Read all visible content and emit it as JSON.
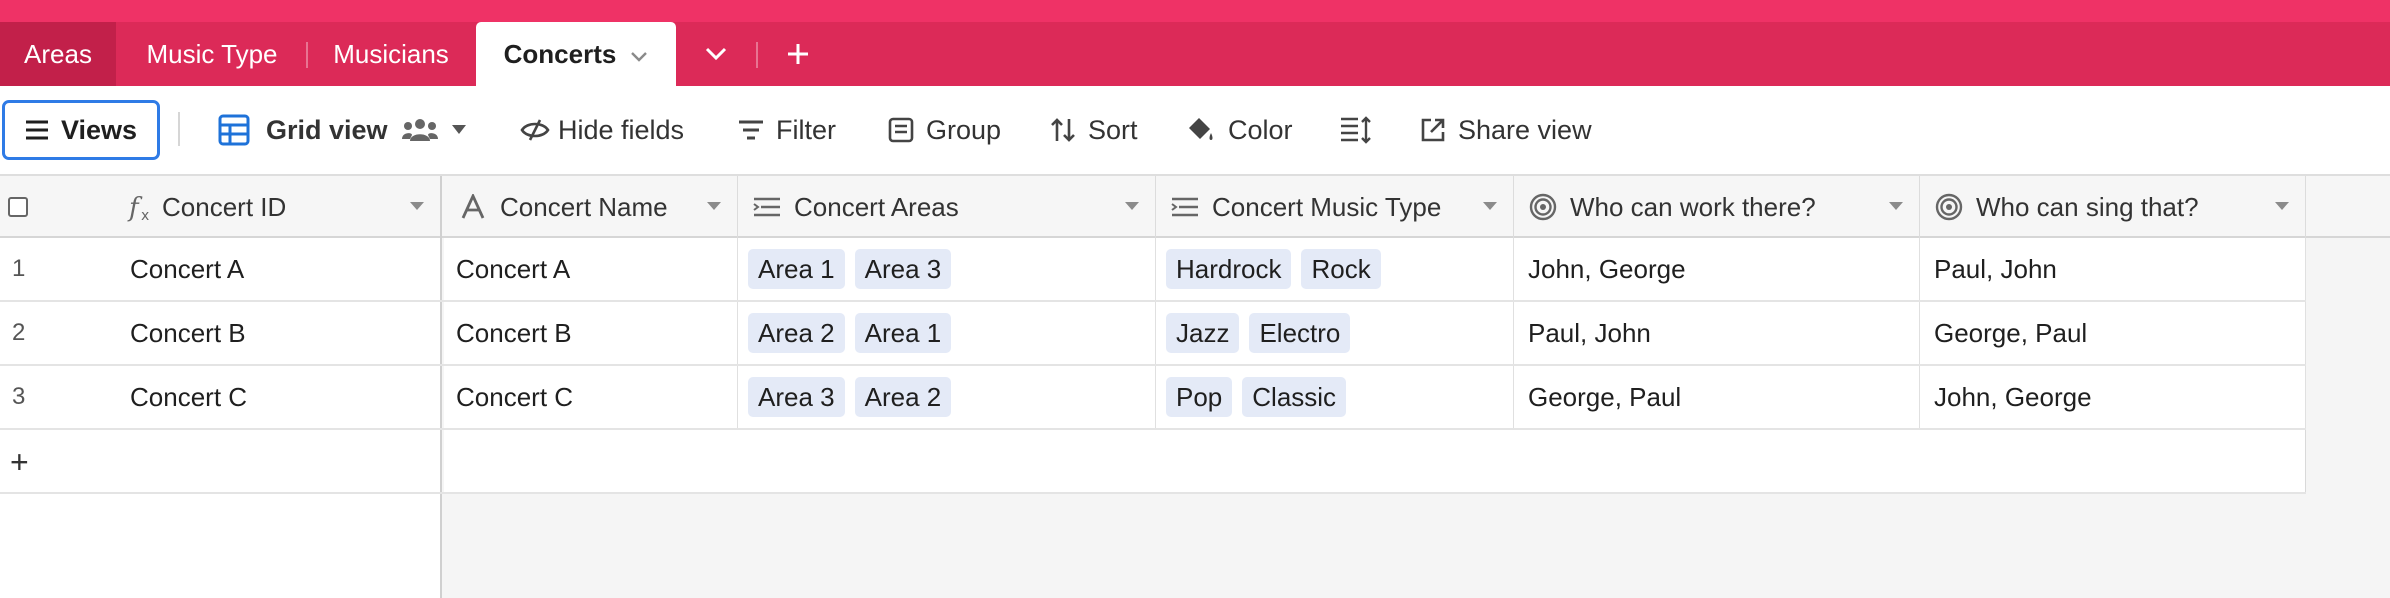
{
  "tabs": [
    {
      "label": "Areas"
    },
    {
      "label": "Music Type"
    },
    {
      "label": "Musicians"
    },
    {
      "label": "Concerts"
    }
  ],
  "toolbar": {
    "views_label": "Views",
    "grid_view_label": "Grid view",
    "hide_fields_label": "Hide fields",
    "filter_label": "Filter",
    "group_label": "Group",
    "sort_label": "Sort",
    "color_label": "Color",
    "share_view_label": "Share view"
  },
  "columns": [
    {
      "label": "Concert ID",
      "icon": "formula-icon"
    },
    {
      "label": "Concert Name",
      "icon": "text-field-icon"
    },
    {
      "label": "Concert Areas",
      "icon": "linked-record-icon"
    },
    {
      "label": "Concert Music Type",
      "icon": "linked-record-icon"
    },
    {
      "label": "Who can work there?",
      "icon": "lookup-icon"
    },
    {
      "label": "Who can sing that?",
      "icon": "lookup-icon"
    }
  ],
  "rows": [
    {
      "num": "1",
      "id": "Concert A",
      "name": "Concert A",
      "areas": [
        "Area 1",
        "Area 3"
      ],
      "types": [
        "Hardrock",
        "Rock"
      ],
      "work": "John, George",
      "sing": "Paul, John"
    },
    {
      "num": "2",
      "id": "Concert B",
      "name": "Concert B",
      "areas": [
        "Area 2",
        "Area 1"
      ],
      "types": [
        "Jazz",
        "Electro"
      ],
      "work": "Paul, John",
      "sing": "George, Paul"
    },
    {
      "num": "3",
      "id": "Concert C",
      "name": "Concert C",
      "areas": [
        "Area 3",
        "Area 2"
      ],
      "types": [
        "Pop",
        "Classic"
      ],
      "work": "George, Paul",
      "sing": "John, George"
    }
  ],
  "add_row_symbol": "+",
  "colors": {
    "tabbar_top": "#ef3266",
    "tabbar": "#dc2a58",
    "accent_blue": "#2f7be6",
    "pill_bg": "#e4eaf7"
  }
}
